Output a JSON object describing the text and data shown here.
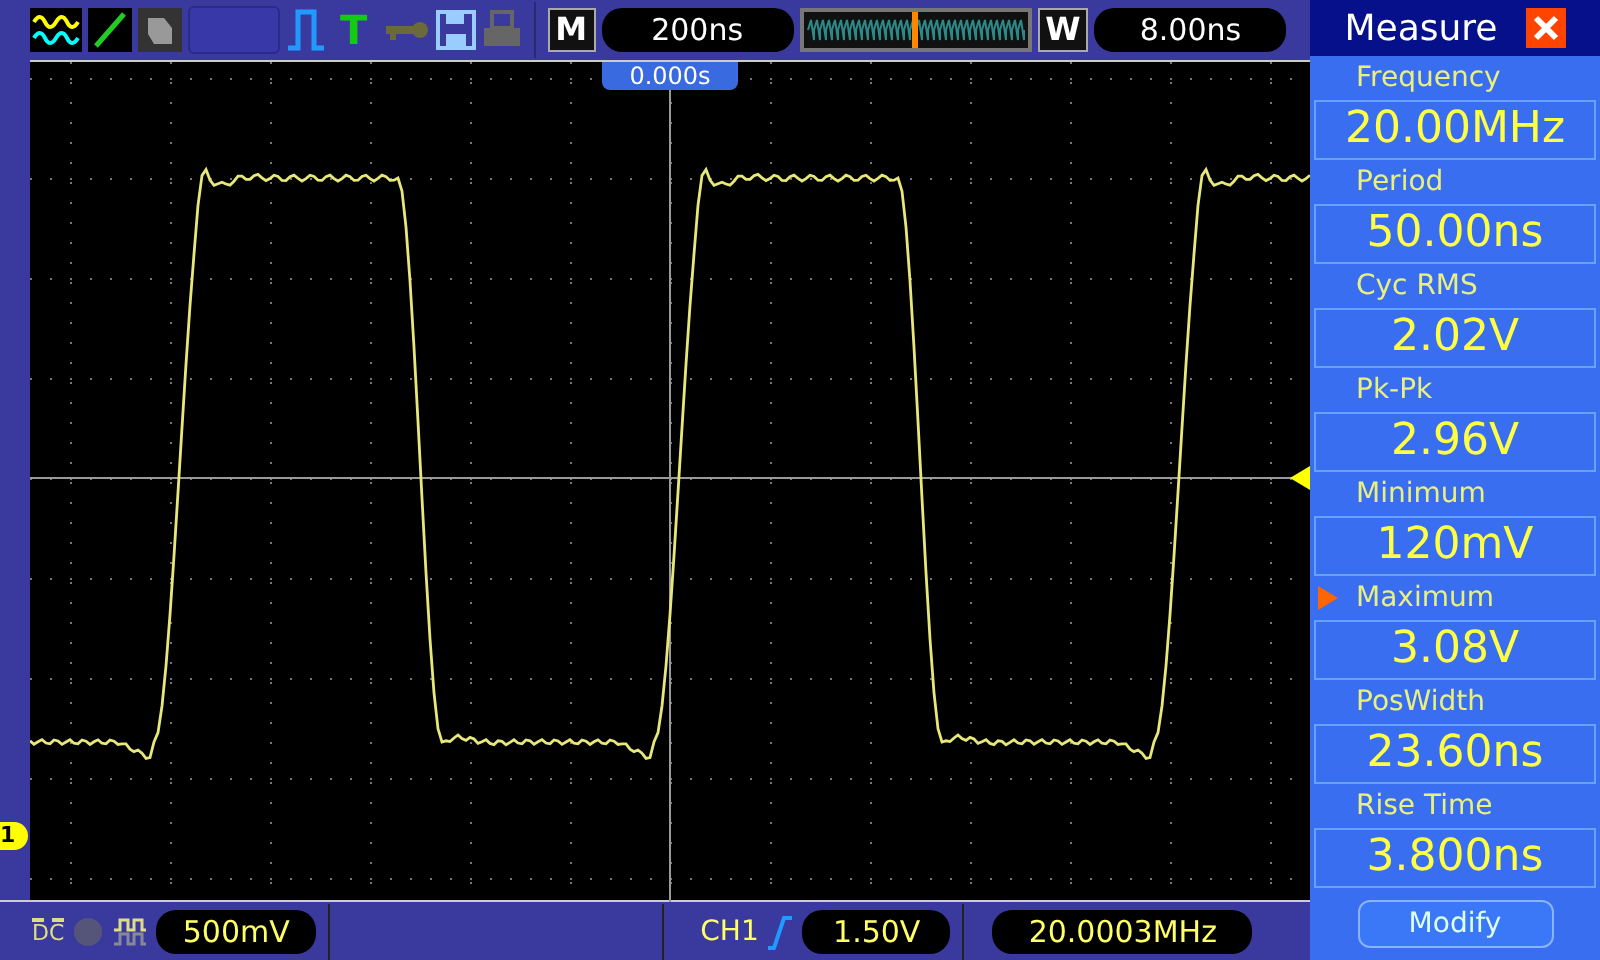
{
  "top_bar": {
    "trigger_type": "T",
    "horizontal_badge": "M",
    "timebase": "200ns",
    "window_badge": "W",
    "window_timebase": "8.00ns"
  },
  "display": {
    "trigger_position": "0.000s",
    "channel_marker": "1"
  },
  "bottom_bar": {
    "coupling": "DC",
    "volts_per_div": "500mV",
    "trigger_source": "CH1",
    "trigger_level": "1.50V",
    "frequency": "20.0003MHz"
  },
  "measure": {
    "title": "Measure",
    "items": [
      {
        "label": "Frequency",
        "value": "20.00MHz",
        "selected": false
      },
      {
        "label": "Period",
        "value": "50.00ns",
        "selected": false
      },
      {
        "label": "Cyc RMS",
        "value": "2.02V",
        "selected": false
      },
      {
        "label": "Pk-Pk",
        "value": "2.96V",
        "selected": false
      },
      {
        "label": "Minimum",
        "value": "120mV",
        "selected": false
      },
      {
        "label": "Maximum",
        "value": "3.08V",
        "selected": true
      },
      {
        "label": "PosWidth",
        "value": "23.60ns",
        "selected": false
      },
      {
        "label": "Rise Time",
        "value": "3.800ns",
        "selected": false
      }
    ],
    "button": "Modify"
  }
}
